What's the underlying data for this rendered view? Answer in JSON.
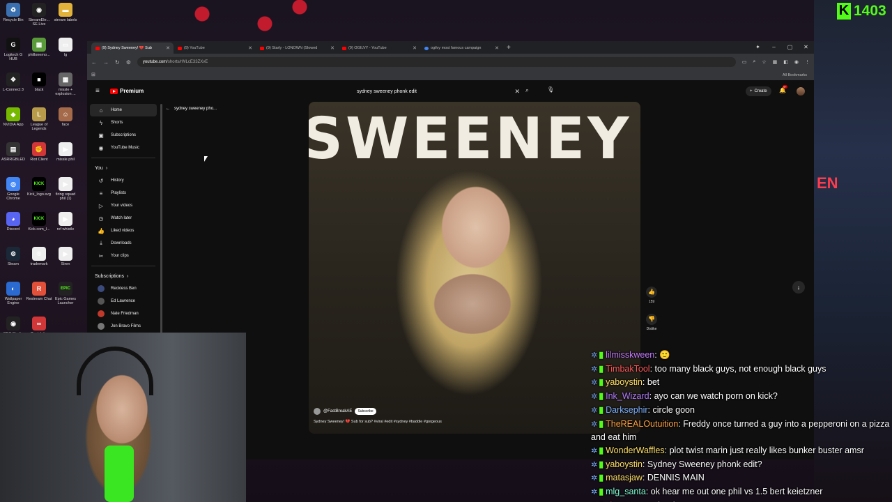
{
  "kick": {
    "count": "1403"
  },
  "desktop": [
    {
      "label": "Recycle Bin",
      "color": "#3a6fb0",
      "glyph": "♻"
    },
    {
      "label": "StreamEle... SE.Live",
      "color": "#222",
      "glyph": "◉"
    },
    {
      "label": "stream labels",
      "color": "#e2b33a",
      "glyph": "▬"
    },
    {
      "label": "Logitech G HUB",
      "color": "#111",
      "glyph": "G"
    },
    {
      "label": "phillonemo...",
      "color": "#5a9a3a",
      "glyph": "▦"
    },
    {
      "label": "lg",
      "color": "#eee",
      "glyph": "▭"
    },
    {
      "label": "L-Connect 3",
      "color": "#222",
      "glyph": "✥"
    },
    {
      "label": "black",
      "color": "#000",
      "glyph": "■"
    },
    {
      "label": "missle + explosion ...",
      "color": "#666",
      "glyph": "▦"
    },
    {
      "label": "NVIDIA App",
      "color": "#76b900",
      "glyph": "◆"
    },
    {
      "label": "League of Legends",
      "color": "#b89b4a",
      "glyph": "L"
    },
    {
      "label": "face",
      "color": "#a56a4a",
      "glyph": "☺"
    },
    {
      "label": "ASRRGBLED",
      "color": "#333",
      "glyph": "▤"
    },
    {
      "label": "Riot Client",
      "color": "#d13639",
      "glyph": "✊"
    },
    {
      "label": "missle phil",
      "color": "#eee",
      "glyph": "▶"
    },
    {
      "label": "Google Chrome",
      "color": "#4285f4",
      "glyph": "◎"
    },
    {
      "label": "Kick_logo.svg",
      "color": "#000",
      "glyph": "KICK"
    },
    {
      "label": "firing squad phil (1)",
      "color": "#eee",
      "glyph": "▶"
    },
    {
      "label": "Discord",
      "color": "#5865f2",
      "glyph": "◕"
    },
    {
      "label": "Kick.com_l...",
      "color": "#000",
      "glyph": "KICK"
    },
    {
      "label": "ref whistle",
      "color": "#eee",
      "glyph": "▶"
    },
    {
      "label": "Steam",
      "color": "#1b2838",
      "glyph": "⚙"
    },
    {
      "label": "trademark",
      "color": "#eee",
      "glyph": "®"
    },
    {
      "label": "Siren",
      "color": "#eee",
      "glyph": "▶"
    },
    {
      "label": "Wallpaper Engine",
      "color": "#2a6ad1",
      "glyph": "◐"
    },
    {
      "label": "Restream Chat",
      "color": "#e2503a",
      "glyph": "R"
    },
    {
      "label": "Epic Games Launcher",
      "color": "#222",
      "glyph": "EPIC"
    },
    {
      "label": "OBS Studio",
      "color": "#222",
      "glyph": "◉"
    },
    {
      "label": "Castelabs",
      "color": "#d13639",
      "glyph": "∞"
    }
  ],
  "browser": {
    "tabs": [
      {
        "title": "(9) Sydney Sweeney! 💔 Sub",
        "active": true,
        "icon": "youtube"
      },
      {
        "title": "(9) YouTube",
        "active": false,
        "icon": "youtube"
      },
      {
        "title": "(9) Starly - LONOWN (Slowed",
        "active": false,
        "icon": "youtube"
      },
      {
        "title": "(9) OGILVY - YouTube",
        "active": false,
        "icon": "youtube"
      },
      {
        "title": "ogilvy most famous campaign",
        "active": false,
        "icon": "google"
      }
    ],
    "url_host": "youtube.com",
    "url_path": "/shorts/rWLcE33ZXvE",
    "all_bookmarks": "All Bookmarks"
  },
  "youtube": {
    "logo": "Premium",
    "search_value": "sydney sweeney phonk edit",
    "create_label": "Create",
    "notif_badge": "9+",
    "sidebar": {
      "main": [
        {
          "label": "Home",
          "icon": "⌂",
          "name": "home"
        },
        {
          "label": "Shorts",
          "icon": "ϟ",
          "name": "shorts"
        },
        {
          "label": "Subscriptions",
          "icon": "▣",
          "name": "subscriptions"
        },
        {
          "label": "YouTube Music",
          "icon": "◉",
          "name": "youtube-music"
        }
      ],
      "you_heading": "You",
      "you": [
        {
          "label": "History",
          "icon": "↺",
          "name": "history"
        },
        {
          "label": "Playlists",
          "icon": "≡",
          "name": "playlists"
        },
        {
          "label": "Your videos",
          "icon": "▷",
          "name": "your-videos"
        },
        {
          "label": "Watch later",
          "icon": "◷",
          "name": "watch-later"
        },
        {
          "label": "Liked videos",
          "icon": "👍",
          "name": "liked-videos"
        },
        {
          "label": "Downloads",
          "icon": "⤓",
          "name": "downloads"
        },
        {
          "label": "Your clips",
          "icon": "✂",
          "name": "your-clips"
        }
      ],
      "subs_heading": "Subscriptions",
      "subs": [
        {
          "label": "Reckless Ben",
          "color": "#3a4a7a"
        },
        {
          "label": "Ed Lawrence",
          "color": "#555"
        },
        {
          "label": "Nate Friedman",
          "color": "#c0392b"
        },
        {
          "label": "Jon Bravo Films",
          "color": "#777"
        }
      ]
    },
    "short_title": "sydney sweeney pho...",
    "video": {
      "overlay_text": "SWEENEY",
      "channel": "@FastBreakAE",
      "subscribe": "Subscribe",
      "description": "Sydney Sweeney! 💔 Sub for sub? #viral #edit #sydney #baddie #gorgeous"
    },
    "actions": {
      "likes": "159",
      "dislike": "Dislike"
    }
  },
  "chat": [
    {
      "user": "lilmisskween",
      "color": "#c57bff",
      "text": "🙂",
      "wrap": false
    },
    {
      "user": "TimbakTool",
      "color": "#ff5a5a",
      "text": "too many black guys, not enough black guys",
      "wrap": false
    },
    {
      "user": "yaboystin",
      "color": "#ffe066",
      "text": "bet",
      "wrap": false
    },
    {
      "user": "Ink_Wizard",
      "color": "#b37bff",
      "text": "ayo can we watch porn on kick?",
      "wrap": false
    },
    {
      "user": "Darksephir",
      "color": "#7fb2ff",
      "text": "circle goon",
      "wrap": false
    },
    {
      "user": "TheREALOutuition",
      "color": "#ffa040",
      "text": "Freddy once turned a guy into a pepperoni on a pizza and eat him",
      "wrap": true
    },
    {
      "user": "WonderWaffles",
      "color": "#ffe066",
      "text": "plot twist marin just really likes bunker buster amsr",
      "wrap": false
    },
    {
      "user": "yaboystin",
      "color": "#ffe066",
      "text": "Sydney Sweeney phonk edit?",
      "wrap": false
    },
    {
      "user": "matasjaw",
      "color": "#ffe066",
      "text": "DENNIS MAIN",
      "wrap": false
    },
    {
      "user": "mlg_santa",
      "color": "#7fffd4",
      "text": "ok hear me out one phil vs 1.5 bert keietzner",
      "wrap": false
    },
    {
      "user": "chantereves",
      "color": "#ff5a5a",
      "text": "brothers, we must stay strong",
      "wrap": false
    }
  ]
}
